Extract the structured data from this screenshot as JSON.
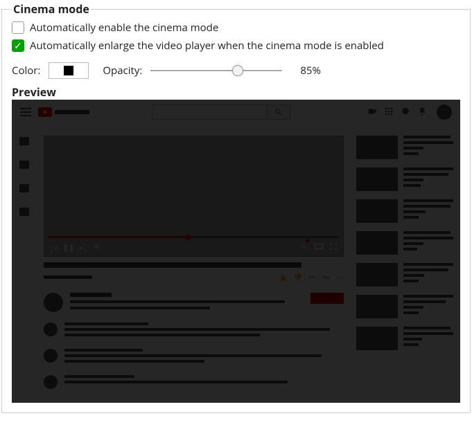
{
  "section_title": "Cinema mode",
  "option_auto_enable": {
    "label": "Automatically enable the cinema mode",
    "checked": false
  },
  "option_auto_enlarge": {
    "label": "Automatically enlarge the video player when the cinema mode is enabled",
    "checked": true
  },
  "color": {
    "label": "Color:",
    "value": "#000000"
  },
  "opacity": {
    "label": "Opacity:",
    "value": 85,
    "display": "85%"
  },
  "preview_label": "Preview"
}
